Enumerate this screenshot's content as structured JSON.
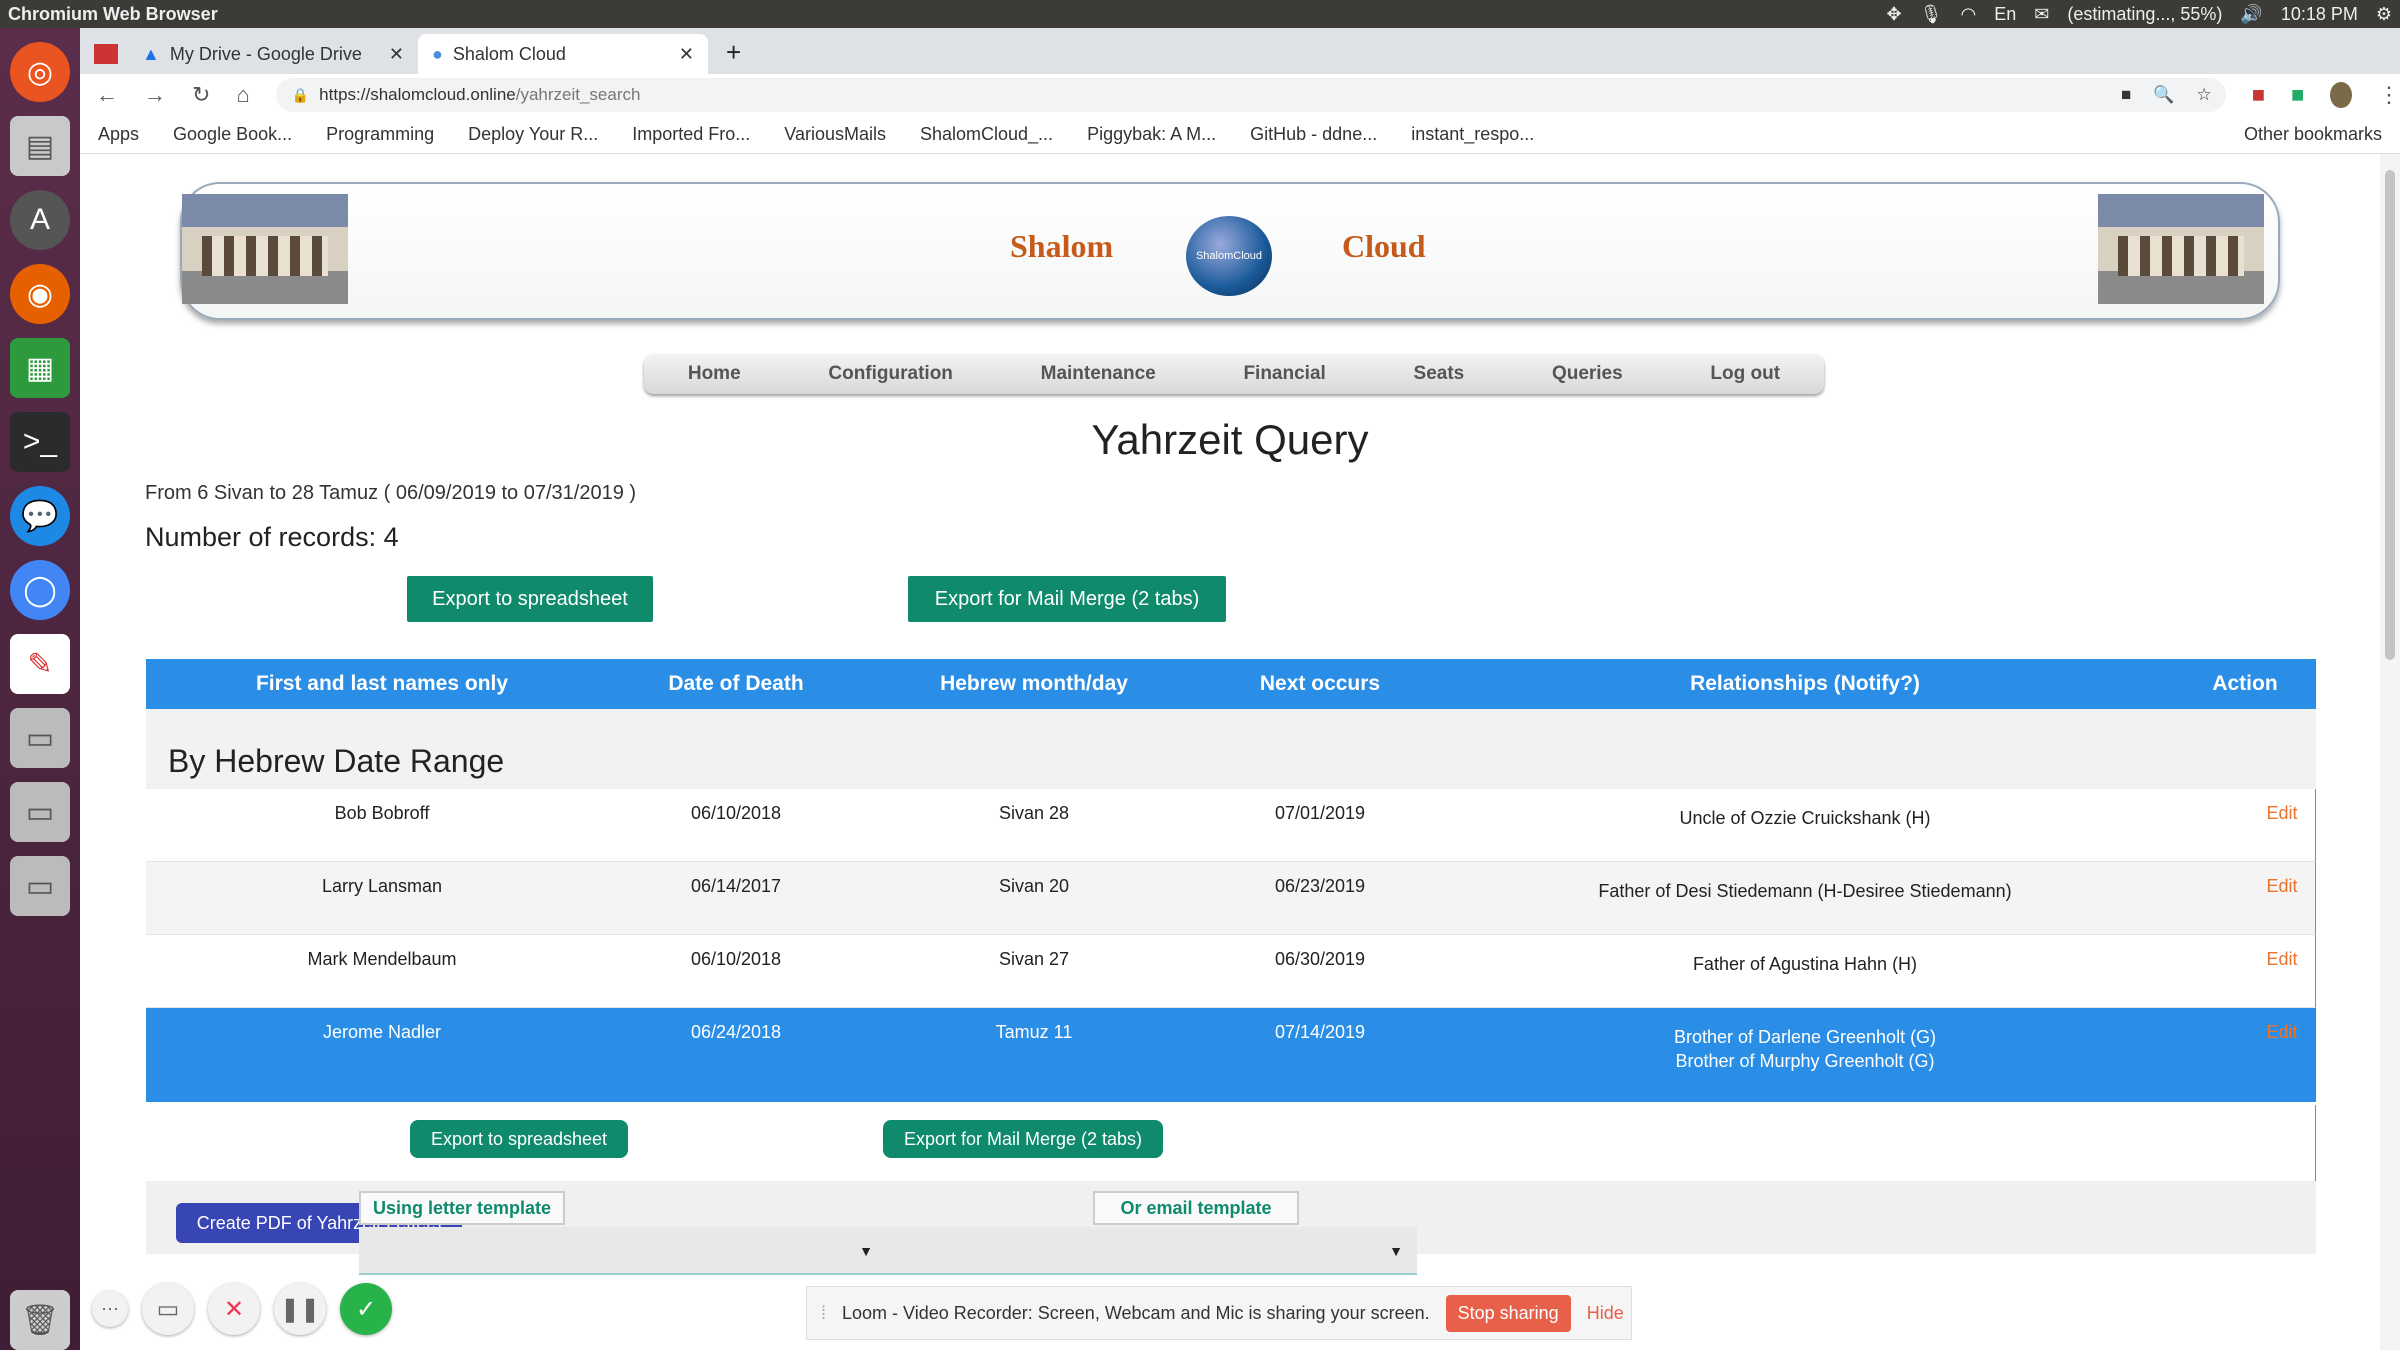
{
  "os": {
    "app_title": "Chromium Web Browser",
    "battery": "(estimating..., 55%)",
    "time": "10:18 PM",
    "keyboard": "En"
  },
  "browser": {
    "tabs": [
      {
        "label": "My Drive - Google Drive",
        "icon": "google-drive-icon"
      },
      {
        "label": "Shalom Cloud",
        "icon": "globe-icon"
      }
    ],
    "url_host": "https://shalomcloud.online",
    "url_path": "/yahrzeit_search",
    "bookmarks": [
      "Apps",
      "Google Book...",
      "Programming",
      "Deploy Your R...",
      "Imported Fro...",
      "VariousMails",
      "ShalomCloud_...",
      "Piggybak: A M...",
      "GitHub - ddne...",
      "instant_respo..."
    ],
    "other_bookmarks": "Other bookmarks"
  },
  "banner": {
    "left": "Shalom",
    "right": "Cloud",
    "logo_text": "ShalomCloud"
  },
  "nav": [
    "Home",
    "Configuration",
    "Maintenance",
    "Financial",
    "Seats",
    "Queries",
    "Log out"
  ],
  "query": {
    "title": "Yahrzeit Query",
    "range": "From 6 Sivan to 28 Tamuz ( 06/09/2019 to 07/31/2019 )",
    "count": "Number of records: 4",
    "export_spreadsheet": "Export to spreadsheet",
    "export_mail_merge": "Export for Mail Merge (2 tabs)"
  },
  "table": {
    "headers": [
      "First and last names only",
      "Date of Death",
      "Hebrew month/day",
      "Next occurs",
      "Relationships (Notify?)",
      "Action"
    ],
    "group": "By Hebrew Date Range",
    "rows": [
      {
        "name": "Bob Bobroff",
        "dod": "06/10/2018",
        "hebrew": "Sivan 28",
        "next": "07/01/2019",
        "rel1": "Uncle of Ozzie Cruickshank (H)",
        "rel2": "",
        "action": "Edit"
      },
      {
        "name": "Larry Lansman",
        "dod": "06/14/2017",
        "hebrew": "Sivan 20",
        "next": "06/23/2019",
        "rel1": "Father of Desi Stiedemann (H-Desiree Stiedemann)",
        "rel2": "",
        "action": "Edit"
      },
      {
        "name": "Mark Mendelbaum",
        "dod": "06/10/2018",
        "hebrew": "Sivan 27",
        "next": "06/30/2019",
        "rel1": "Father of Agustina Hahn (H)",
        "rel2": "",
        "action": "Edit"
      },
      {
        "name": "Jerome Nadler",
        "dod": "06/24/2018",
        "hebrew": "Tamuz 11",
        "next": "07/14/2019",
        "rel1": "Brother of Darlene Greenholt (G)",
        "rel2": "Brother of Murphy Greenholt (G)",
        "action": "Edit"
      }
    ]
  },
  "lower": {
    "export_spreadsheet": "Export to spreadsheet",
    "export_mail_merge": "Export for Mail Merge (2 tabs)",
    "create_pdf": "Create PDF of Yahrzeit Letters",
    "letter_template": "Using letter template",
    "email_template": "Or email template"
  },
  "loom": {
    "message": "Loom - Video Recorder: Screen, Webcam and Mic is sharing your screen.",
    "stop": "Stop sharing",
    "hide": "Hide"
  }
}
